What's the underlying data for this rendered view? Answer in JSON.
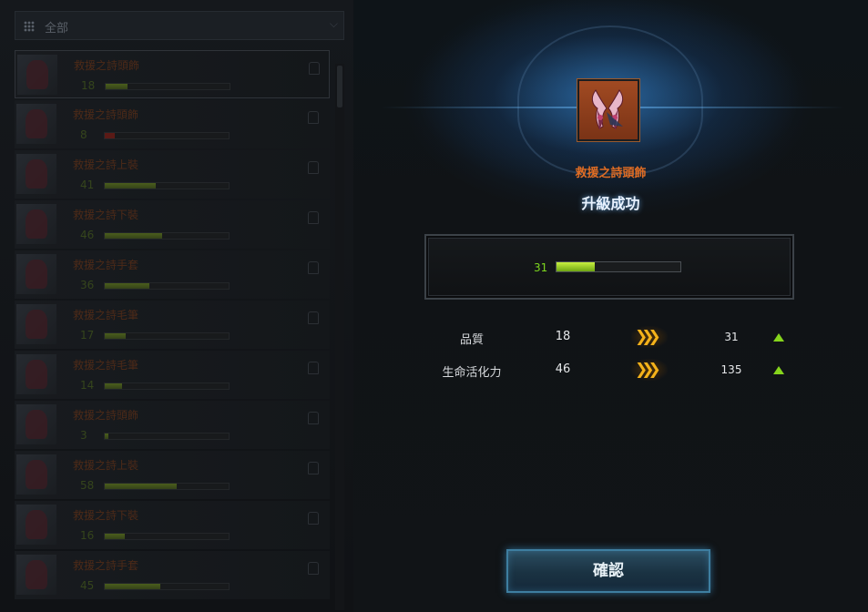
{
  "filter": {
    "label": "全部"
  },
  "list": [
    {
      "name": "救援之詩頭飾",
      "level": "18",
      "fill": 0.18,
      "color": "green",
      "selected": true
    },
    {
      "name": "救援之詩頭飾",
      "level": "8",
      "fill": 0.08,
      "color": "red"
    },
    {
      "name": "救援之詩上裝",
      "level": "41",
      "fill": 0.41,
      "color": "green"
    },
    {
      "name": "救援之詩下裝",
      "level": "46",
      "fill": 0.46,
      "color": "green"
    },
    {
      "name": "救援之詩手套",
      "level": "36",
      "fill": 0.36,
      "color": "green"
    },
    {
      "name": "救援之詩毛筆",
      "level": "17",
      "fill": 0.17,
      "color": "green"
    },
    {
      "name": "救援之詩毛筆",
      "level": "14",
      "fill": 0.14,
      "color": "green"
    },
    {
      "name": "救援之詩頭飾",
      "level": "3",
      "fill": 0.03,
      "color": "green"
    },
    {
      "name": "救援之詩上裝",
      "level": "58",
      "fill": 0.58,
      "color": "green"
    },
    {
      "name": "救援之詩下裝",
      "level": "16",
      "fill": 0.16,
      "color": "green"
    },
    {
      "name": "救援之詩手套",
      "level": "45",
      "fill": 0.45,
      "color": "green"
    }
  ],
  "popup": {
    "item_name": "救援之詩頭飾",
    "result": "升級成功",
    "level": "31",
    "level_fill": 0.31,
    "stats": [
      {
        "label": "品質",
        "old": "18",
        "new": "31"
      },
      {
        "label": "生命活化力",
        "old": "46",
        "new": "135"
      }
    ],
    "arrows": "❯❯❯",
    "confirm_label": "確認"
  },
  "colors": {
    "accent_orange": "#e06d24",
    "level_green": "#7ed81e",
    "arrow_gold": "#f4b21a",
    "confirm_border": "#3e7ea0"
  },
  "icons": [
    "menu-grid-icon",
    "lock-icon",
    "upgrade-arrows-icon",
    "increase-triangle-icon"
  ]
}
